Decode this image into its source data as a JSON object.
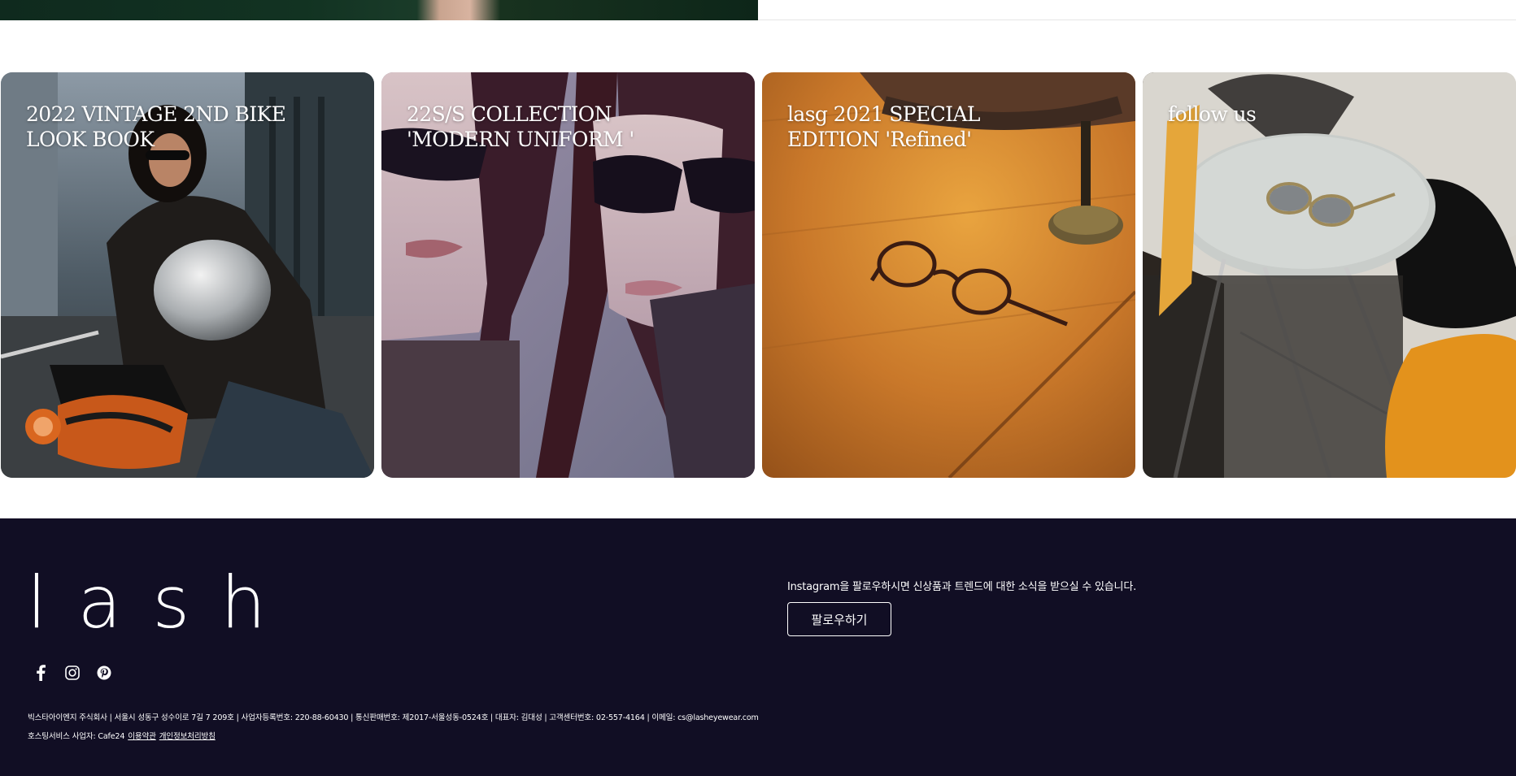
{
  "cards": [
    {
      "title": "2022 VINTAGE 2ND BIKE\nLOOK BOOK"
    },
    {
      "title": "22S/S COLLECTION\n'MODERN UNIFORM '"
    },
    {
      "title": "lasg 2021 SPECIAL\nEDITION 'Refined'"
    },
    {
      "title": "follow us"
    }
  ],
  "footer": {
    "logo": "lash",
    "social": [
      "facebook-icon",
      "instagram-icon",
      "pinterest-icon"
    ],
    "follow_text": "Instagram을 팔로우하시면 신상품과 트렌드에 대한 소식을 받으실 수 있습니다.",
    "follow_button": "팔로우하기",
    "company_info": "빅스타아이엔지 주식회사 | 서울시 성동구 성수이로 7길 7 209호 | 사업자등록번호: 220-88-60430 | 통신판매번호: 제2017-서울성동-0524호 | 대표자: 김대성 | 고객센터번호: 02-557-4164 | 이메일: cs@lasheyewear.com",
    "hosting_label": "호스팅서비스 사업자: Cafe24",
    "terms_link": "이용약관",
    "privacy_link": "개인정보처리방침"
  }
}
